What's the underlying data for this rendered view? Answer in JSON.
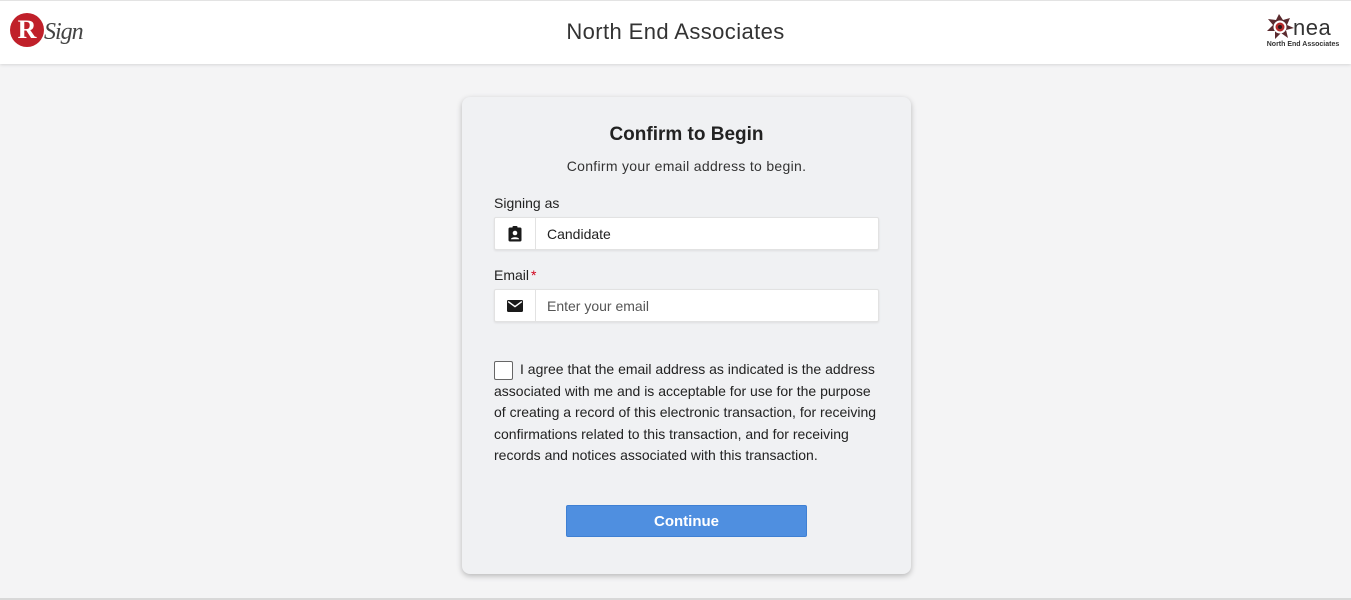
{
  "header": {
    "logo_left_letter": "R",
    "logo_left_word": "Sign",
    "title": "North End Associates",
    "logo_right_text": "nea",
    "logo_right_subtitle": "North End Associates"
  },
  "card": {
    "title": "Confirm to Begin",
    "subtitle": "Confirm your email address to begin.",
    "signing_as": {
      "label": "Signing as",
      "value": "Candidate",
      "icon": "contact-card-icon"
    },
    "email": {
      "label": "Email",
      "required_mark": "*",
      "placeholder": "Enter your email",
      "value": "",
      "icon": "envelope-icon"
    },
    "agreement": {
      "checked": false,
      "text": "I agree that the email address as indicated is the address associated with me and is acceptable for use for the purpose of creating a record of this electronic transaction, for receiving confirmations related to this transaction, and for receiving records and notices associated with this transaction."
    },
    "continue_label": "Continue"
  },
  "colors": {
    "brand_red": "#c0202a",
    "button_blue": "#4f8fe0",
    "required_red": "#d0021b",
    "card_bg": "#f0f1f3",
    "page_bg": "#f4f4f5"
  }
}
